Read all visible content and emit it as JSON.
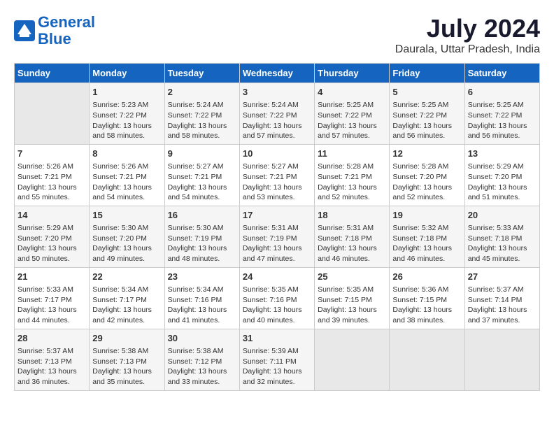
{
  "logo": {
    "line1": "General",
    "line2": "Blue"
  },
  "title": "July 2024",
  "subtitle": "Daurala, Uttar Pradesh, India",
  "days": [
    "Sunday",
    "Monday",
    "Tuesday",
    "Wednesday",
    "Thursday",
    "Friday",
    "Saturday"
  ],
  "weeks": [
    [
      {
        "date": "",
        "info": ""
      },
      {
        "date": "1",
        "info": "Sunrise: 5:23 AM\nSunset: 7:22 PM\nDaylight: 13 hours\nand 58 minutes."
      },
      {
        "date": "2",
        "info": "Sunrise: 5:24 AM\nSunset: 7:22 PM\nDaylight: 13 hours\nand 58 minutes."
      },
      {
        "date": "3",
        "info": "Sunrise: 5:24 AM\nSunset: 7:22 PM\nDaylight: 13 hours\nand 57 minutes."
      },
      {
        "date": "4",
        "info": "Sunrise: 5:25 AM\nSunset: 7:22 PM\nDaylight: 13 hours\nand 57 minutes."
      },
      {
        "date": "5",
        "info": "Sunrise: 5:25 AM\nSunset: 7:22 PM\nDaylight: 13 hours\nand 56 minutes."
      },
      {
        "date": "6",
        "info": "Sunrise: 5:25 AM\nSunset: 7:22 PM\nDaylight: 13 hours\nand 56 minutes."
      }
    ],
    [
      {
        "date": "7",
        "info": "Sunrise: 5:26 AM\nSunset: 7:21 PM\nDaylight: 13 hours\nand 55 minutes."
      },
      {
        "date": "8",
        "info": "Sunrise: 5:26 AM\nSunset: 7:21 PM\nDaylight: 13 hours\nand 54 minutes."
      },
      {
        "date": "9",
        "info": "Sunrise: 5:27 AM\nSunset: 7:21 PM\nDaylight: 13 hours\nand 54 minutes."
      },
      {
        "date": "10",
        "info": "Sunrise: 5:27 AM\nSunset: 7:21 PM\nDaylight: 13 hours\nand 53 minutes."
      },
      {
        "date": "11",
        "info": "Sunrise: 5:28 AM\nSunset: 7:21 PM\nDaylight: 13 hours\nand 52 minutes."
      },
      {
        "date": "12",
        "info": "Sunrise: 5:28 AM\nSunset: 7:20 PM\nDaylight: 13 hours\nand 52 minutes."
      },
      {
        "date": "13",
        "info": "Sunrise: 5:29 AM\nSunset: 7:20 PM\nDaylight: 13 hours\nand 51 minutes."
      }
    ],
    [
      {
        "date": "14",
        "info": "Sunrise: 5:29 AM\nSunset: 7:20 PM\nDaylight: 13 hours\nand 50 minutes."
      },
      {
        "date": "15",
        "info": "Sunrise: 5:30 AM\nSunset: 7:20 PM\nDaylight: 13 hours\nand 49 minutes."
      },
      {
        "date": "16",
        "info": "Sunrise: 5:30 AM\nSunset: 7:19 PM\nDaylight: 13 hours\nand 48 minutes."
      },
      {
        "date": "17",
        "info": "Sunrise: 5:31 AM\nSunset: 7:19 PM\nDaylight: 13 hours\nand 47 minutes."
      },
      {
        "date": "18",
        "info": "Sunrise: 5:31 AM\nSunset: 7:18 PM\nDaylight: 13 hours\nand 46 minutes."
      },
      {
        "date": "19",
        "info": "Sunrise: 5:32 AM\nSunset: 7:18 PM\nDaylight: 13 hours\nand 46 minutes."
      },
      {
        "date": "20",
        "info": "Sunrise: 5:33 AM\nSunset: 7:18 PM\nDaylight: 13 hours\nand 45 minutes."
      }
    ],
    [
      {
        "date": "21",
        "info": "Sunrise: 5:33 AM\nSunset: 7:17 PM\nDaylight: 13 hours\nand 44 minutes."
      },
      {
        "date": "22",
        "info": "Sunrise: 5:34 AM\nSunset: 7:17 PM\nDaylight: 13 hours\nand 42 minutes."
      },
      {
        "date": "23",
        "info": "Sunrise: 5:34 AM\nSunset: 7:16 PM\nDaylight: 13 hours\nand 41 minutes."
      },
      {
        "date": "24",
        "info": "Sunrise: 5:35 AM\nSunset: 7:16 PM\nDaylight: 13 hours\nand 40 minutes."
      },
      {
        "date": "25",
        "info": "Sunrise: 5:35 AM\nSunset: 7:15 PM\nDaylight: 13 hours\nand 39 minutes."
      },
      {
        "date": "26",
        "info": "Sunrise: 5:36 AM\nSunset: 7:15 PM\nDaylight: 13 hours\nand 38 minutes."
      },
      {
        "date": "27",
        "info": "Sunrise: 5:37 AM\nSunset: 7:14 PM\nDaylight: 13 hours\nand 37 minutes."
      }
    ],
    [
      {
        "date": "28",
        "info": "Sunrise: 5:37 AM\nSunset: 7:13 PM\nDaylight: 13 hours\nand 36 minutes."
      },
      {
        "date": "29",
        "info": "Sunrise: 5:38 AM\nSunset: 7:13 PM\nDaylight: 13 hours\nand 35 minutes."
      },
      {
        "date": "30",
        "info": "Sunrise: 5:38 AM\nSunset: 7:12 PM\nDaylight: 13 hours\nand 33 minutes."
      },
      {
        "date": "31",
        "info": "Sunrise: 5:39 AM\nSunset: 7:11 PM\nDaylight: 13 hours\nand 32 minutes."
      },
      {
        "date": "",
        "info": ""
      },
      {
        "date": "",
        "info": ""
      },
      {
        "date": "",
        "info": ""
      }
    ]
  ]
}
